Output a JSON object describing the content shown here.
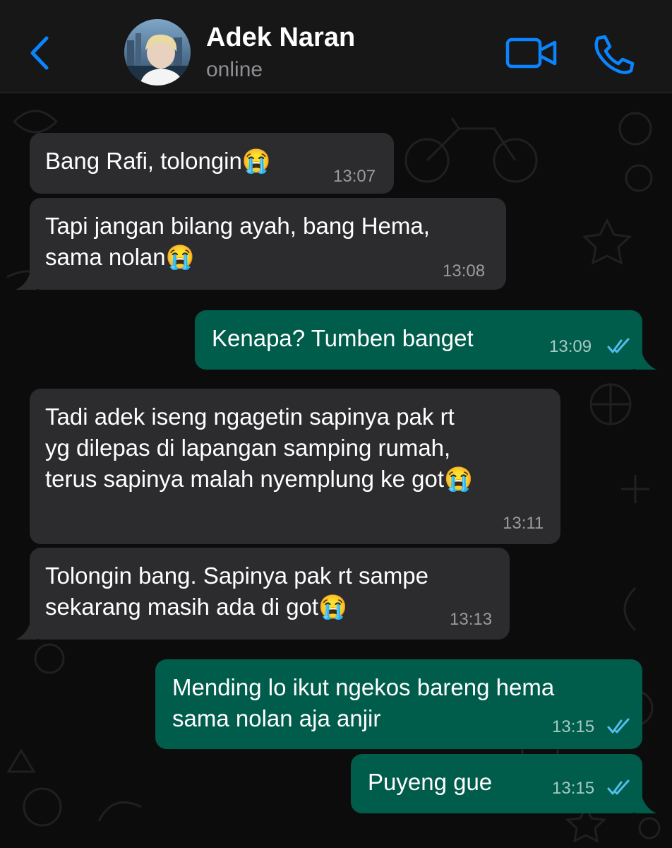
{
  "header": {
    "back_icon": "chevron-left-icon",
    "contact_name": "Adek Naran",
    "status": "online",
    "video_icon": "video-camera-icon",
    "phone_icon": "phone-icon"
  },
  "colors": {
    "accent": "#0a84ff",
    "incoming_bubble": "#2c2c2e",
    "outgoing_bubble": "#005c4b",
    "read_ticks": "#53bdeb"
  },
  "messages": [
    {
      "direction": "in",
      "text": "Bang Rafi, tolongin😭",
      "time": "13:07"
    },
    {
      "direction": "in",
      "text": "Tapi jangan bilang ayah, bang Hema,\nsama nolan😭",
      "time": "13:08"
    },
    {
      "direction": "out",
      "text": "Kenapa? Tumben banget",
      "time": "13:09",
      "status": "read"
    },
    {
      "direction": "in",
      "text": "Tadi adek iseng ngagetin sapinya pak rt\nyg dilepas di lapangan samping rumah,\nterus sapinya malah nyemplung ke got😭",
      "time": "13:11"
    },
    {
      "direction": "in",
      "text": "Tolongin bang. Sapinya pak rt sampe\nsekarang masih ada di got😭",
      "time": "13:13"
    },
    {
      "direction": "out",
      "text": "Mending lo ikut ngekos bareng hema\nsama nolan aja anjir",
      "time": "13:15",
      "status": "read"
    },
    {
      "direction": "out",
      "text": "Puyeng gue",
      "time": "13:15",
      "status": "read"
    }
  ]
}
